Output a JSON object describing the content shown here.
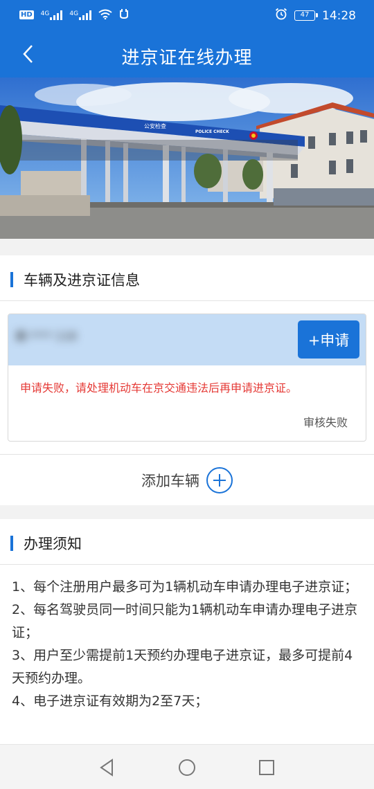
{
  "status_bar": {
    "hd_label": "HD",
    "hd_sub": "2",
    "net1": "4G",
    "net2": "4G",
    "battery": "47",
    "time": "14:28"
  },
  "header": {
    "title": "进京证在线办理"
  },
  "banner": {
    "sign_cn": "公安检查",
    "sign_en": "POLICE CHECK"
  },
  "vehicle_section": {
    "title": "车辆及进京证信息",
    "card": {
      "plate": "冀·**** 118",
      "apply_label": "+申请",
      "message": "申请失败，请处理机动车在京交通违法后再申请进京证。",
      "status": "审核失败"
    },
    "add_vehicle_label": "添加车辆"
  },
  "notice_section": {
    "title": "办理须知",
    "items": [
      "1、每个注册用户最多可为1辆机动车申请办理电子进京证；",
      "2、每名驾驶员同一时间只能为1辆机动车申请办理电子进京证；",
      "3、用户至少需提前1天预约办理电子进京证，最多可提前4天预约办理。",
      "4、电子进京证有效期为2至7天；"
    ]
  },
  "colors": {
    "primary": "#1a73d8",
    "error": "#e53935",
    "card_header": "#c4dcf5"
  }
}
